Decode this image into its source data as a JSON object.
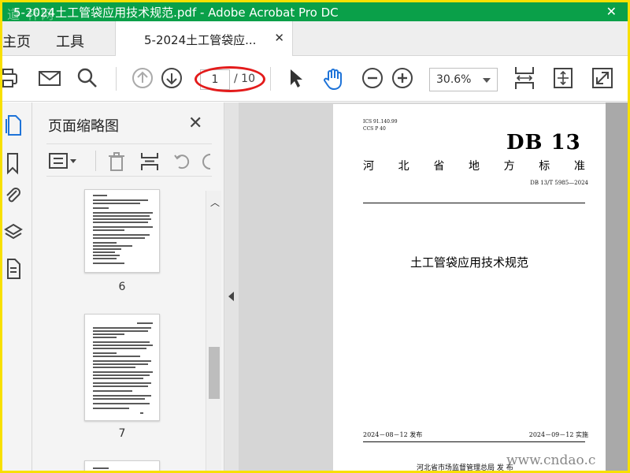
{
  "window": {
    "title": "5-2024土工管袋应用技术规范.pdf - Adobe Acrobat Pro DC",
    "watermark": "道 杯网"
  },
  "tabs": {
    "home": "主页",
    "tools": "工具",
    "document": "5-2024土工管袋应...",
    "close_glyph": "✕"
  },
  "toolbar": {
    "current_page": "1",
    "total_pages": "/ 10",
    "zoom": "30.6%"
  },
  "icons": {
    "toolbar": [
      "print-icon",
      "email-icon",
      "search-icon",
      "page-up-icon",
      "page-down-icon",
      "select-cursor-icon",
      "hand-tool-icon",
      "zoom-out-icon",
      "zoom-in-icon",
      "fit-page-icon",
      "scroll-mode-icon",
      "full-screen-icon"
    ],
    "rail": [
      "page-thumbnails-icon",
      "bookmarks-icon",
      "attachments-icon",
      "layers-icon",
      "document-properties-icon"
    ],
    "panel": [
      "options-menu-icon",
      "delete-icon",
      "insert-page-icon",
      "undo-icon"
    ]
  },
  "thumbnail_panel": {
    "title": "页面缩略图",
    "close_glyph": "✕",
    "thumbnails": [
      {
        "page": "6"
      },
      {
        "page": "7"
      }
    ]
  },
  "document": {
    "ics_line1": "ICS  91.140.99",
    "ics_line2": "CCS  P 40",
    "logo": "DB 13",
    "province_chars": [
      "河",
      "北",
      "省",
      "地",
      "方",
      "标",
      "准"
    ],
    "standard_number": "DB 13/T 5985—2024",
    "title": "土工管袋应用技术规范",
    "issue_date": "2024－08－12 发布",
    "implement_date": "2024－09－12 实施",
    "issuer": "河北省市场监督管理总局      发  布"
  },
  "site_watermark": "www.cndao.c",
  "colors": {
    "title_bar": "#0aa049",
    "frame_border": "#f8e000",
    "annotation": "#e31b1b",
    "hand_tool": "#1e73d8"
  }
}
